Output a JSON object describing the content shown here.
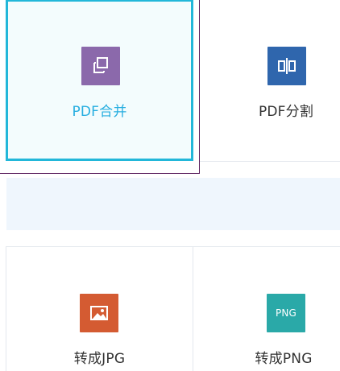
{
  "tools": {
    "merge": {
      "label": "PDF合并",
      "icon": "merge-pages-icon",
      "icon_color": "#8b69ab",
      "label_color": "#27aee0",
      "selected": true
    },
    "split": {
      "label": "PDF分割",
      "icon": "split-pages-icon",
      "icon_color": "#2f66ad"
    },
    "to_jpg": {
      "label": "转成JPG",
      "icon": "image-icon",
      "icon_color": "#d45b32"
    },
    "to_png": {
      "label": "转成PNG",
      "icon": "png-icon",
      "icon_color": "#2aa9a8",
      "icon_text": "PNG"
    }
  },
  "colors": {
    "selection_border": "#22b7d9",
    "band_background": "#eff6fd",
    "divider": "#e4e8ee",
    "text": "#333333"
  }
}
